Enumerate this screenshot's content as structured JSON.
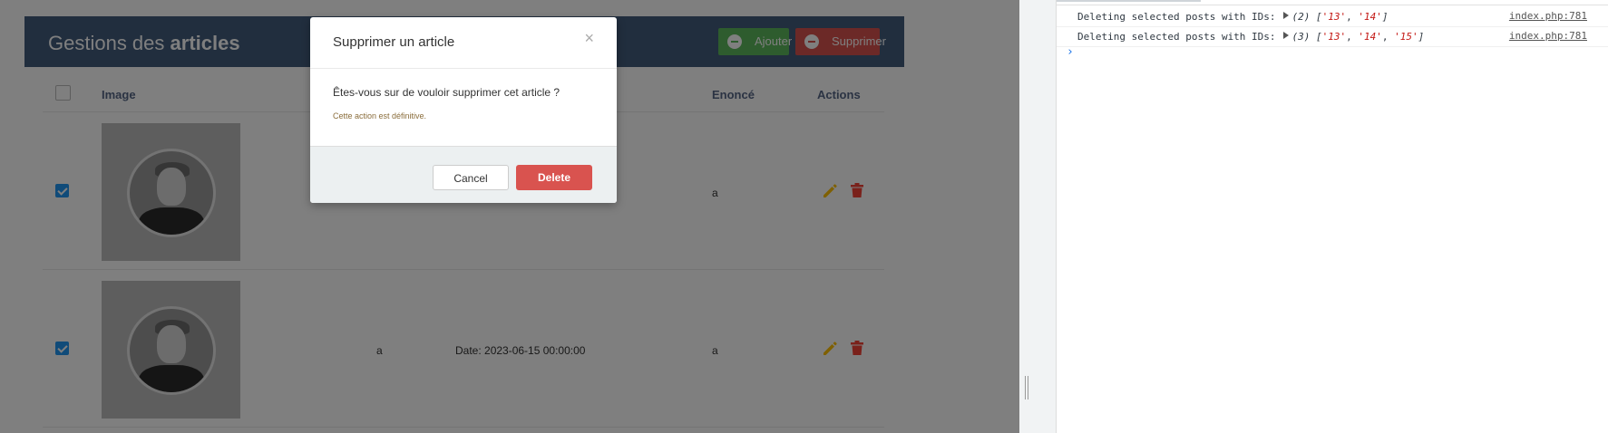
{
  "app": {
    "title_light": "Gestions des ",
    "title_bold": "articles",
    "add_label": "Ajouter",
    "delete_label": "Supprimer",
    "columns": {
      "image": "Image",
      "enonce": "Enoncé",
      "actions": "Actions"
    },
    "rows": [
      {
        "checked": true,
        "col2": "",
        "col3": "",
        "enonce": "a"
      },
      {
        "checked": true,
        "col2": "a",
        "col3": "Date: 2023-06-15 00:00:00",
        "enonce": "a"
      }
    ],
    "colors": {
      "header": "#435d7d",
      "add": "#5cb85c",
      "delete": "#d9534f",
      "edit": "#ffc107",
      "trash": "#f44336",
      "checkbox": "#2196f3"
    }
  },
  "modal": {
    "title": "Supprimer un article",
    "close": "×",
    "message": "Êtes-vous sur de vouloir supprimer cet article ?",
    "warning": "Cette action est définitive.",
    "cancel_label": "Cancel",
    "delete_label": "Delete"
  },
  "console": {
    "logs": [
      {
        "text": "Deleting selected posts with IDs:",
        "count": "(2)",
        "open": "[",
        "ids": [
          "'13'",
          "'14'"
        ],
        "close": "]",
        "source": "index.php:781"
      },
      {
        "text": "Deleting selected posts with IDs:",
        "count": "(3)",
        "open": "[",
        "ids": [
          "'13'",
          "'14'",
          "'15'"
        ],
        "close": "]",
        "source": "index.php:781"
      }
    ],
    "prompt": "›"
  }
}
